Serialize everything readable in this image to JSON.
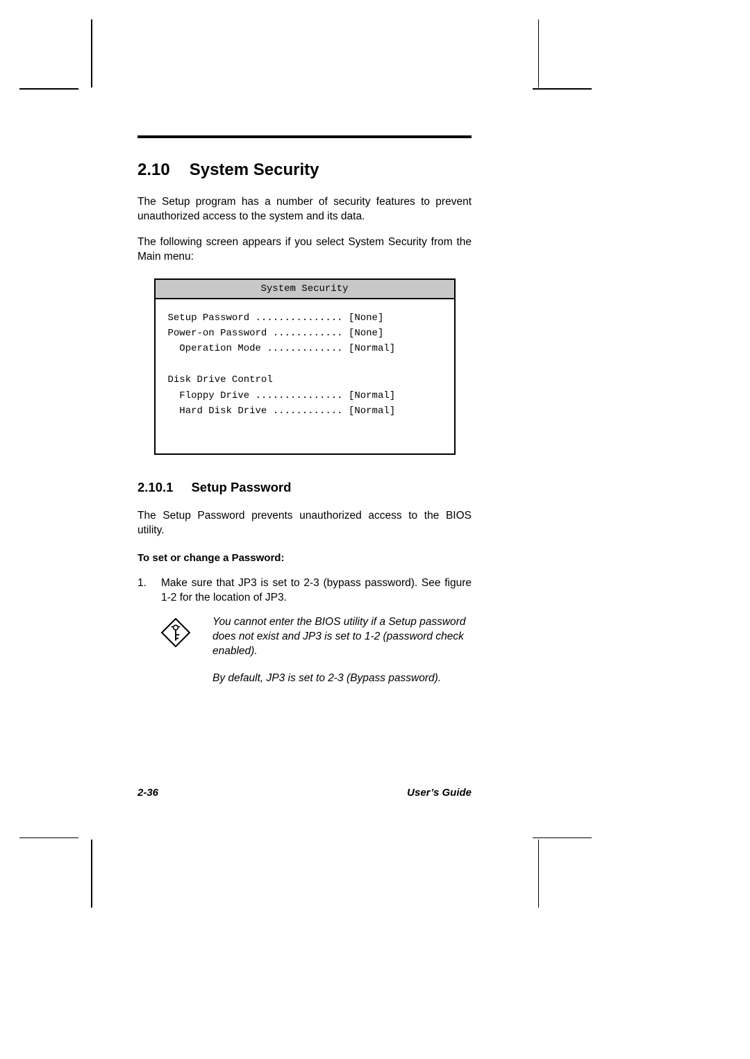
{
  "section": {
    "number": "2.10",
    "title": "System Security",
    "para1": "The Setup program has a number of security features to prevent unauthorized access to the system and its data.",
    "para2": "The following screen appears if you select System Security from the Main menu:"
  },
  "bios": {
    "title": "System Security",
    "body": "Setup Password ............... [None]\nPower-on Password ............ [None]\n  Operation Mode ............. [Normal]\n\nDisk Drive Control\n  Floppy Drive ............... [Normal]\n  Hard Disk Drive ............ [Normal]"
  },
  "subsection": {
    "number": "2.10.1",
    "title": "Setup Password",
    "para": "The Setup Password prevents unauthorized access to the BIOS utility.",
    "bold": "To set or change a Password:",
    "step_num": "1.",
    "step_text": "Make sure that JP3 is set to 2-3 (bypass password).  See figure 1-2 for the location of JP3.",
    "note1": "You cannot enter the BIOS utility if a Setup password does not exist and JP3 is set to 1-2 (password check enabled).",
    "note2": "By default, JP3 is set to 2-3 (Bypass password)."
  },
  "footer": {
    "left": "2-36",
    "right": "User’s Guide"
  }
}
